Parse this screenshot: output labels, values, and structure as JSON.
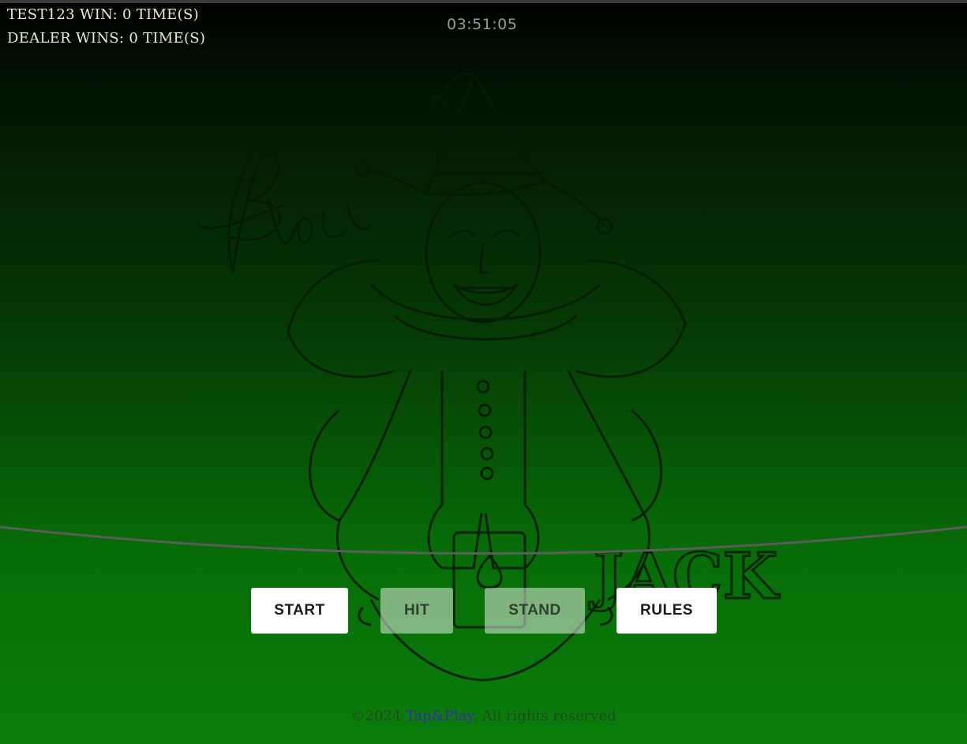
{
  "scoreboard": {
    "player_wins": "TEST123 WIN: 0 TIME(S)",
    "dealer_wins": "DEALER WINS: 0 TIME(S)"
  },
  "timer": "03:51:05",
  "background_art": {
    "logo_script": "Black",
    "logo_block": "JACK",
    "icon": "jester-illustration"
  },
  "controls": {
    "start": "START",
    "hit": "HIT",
    "stand": "STAND",
    "rules": "RULES"
  },
  "footer": {
    "prefix": "©2024 ",
    "brand": "Tap&Play",
    "suffix": ". All rights reserved"
  },
  "colors": {
    "table_top": "#000000",
    "table_bottom": "#0a7d0a",
    "score_text": "#f1ead2",
    "button_bg": "#ffffff",
    "brand_link": "#3a2aa8"
  }
}
